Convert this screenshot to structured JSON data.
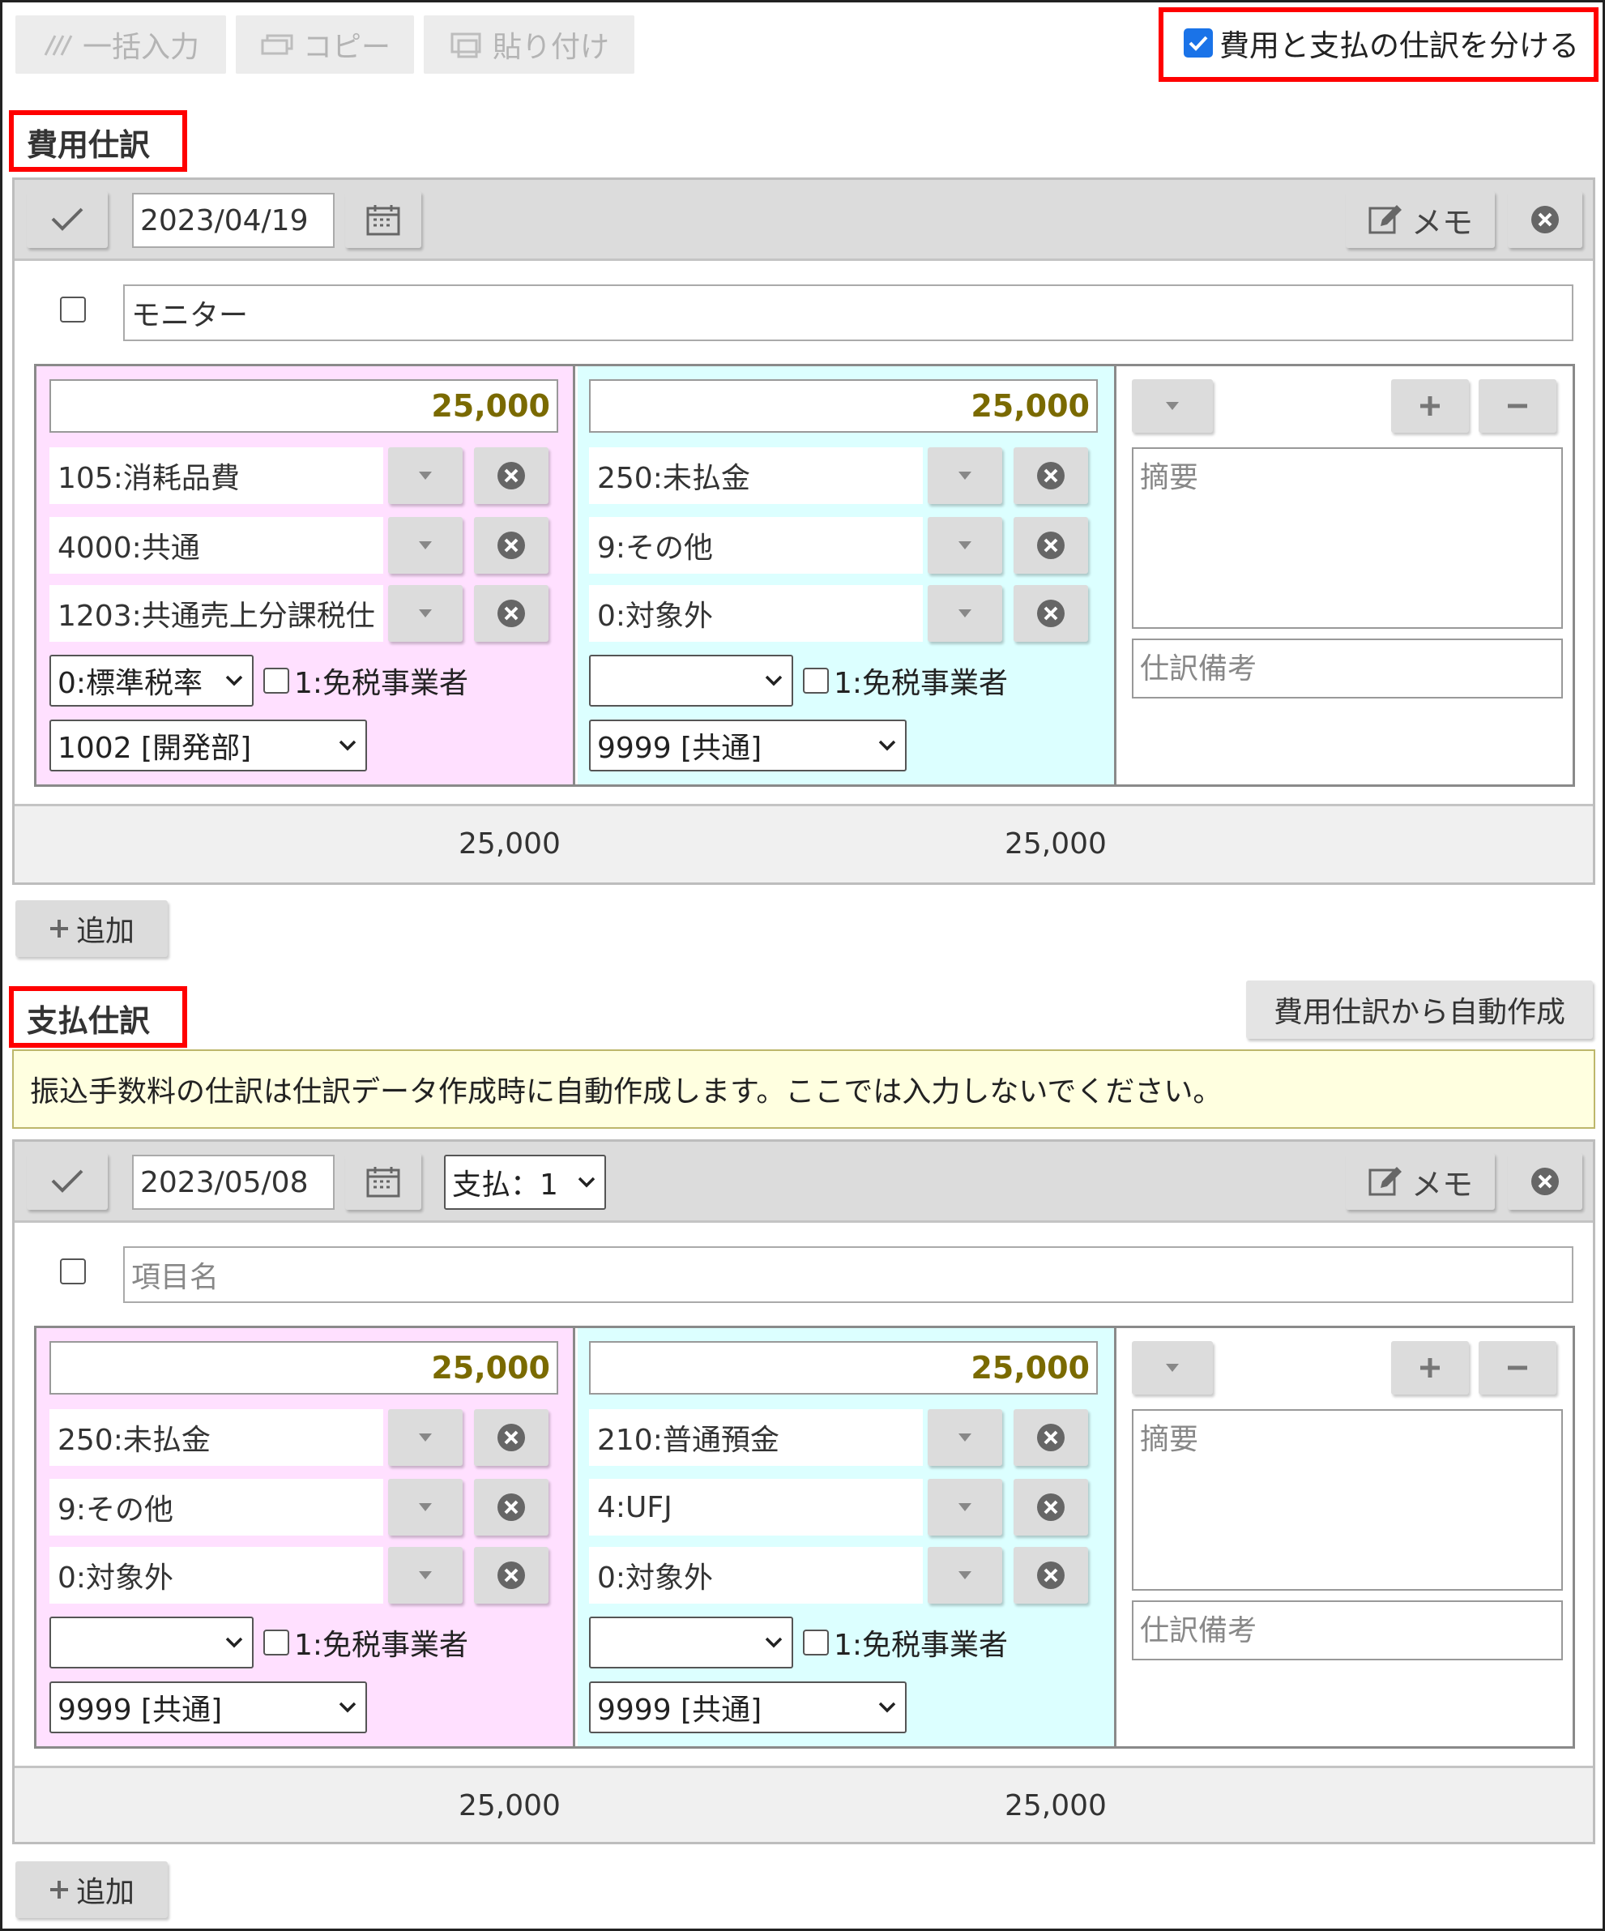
{
  "toolbar": {
    "bulk_input": "一括入力",
    "copy": "コピー",
    "paste": "貼り付け",
    "split_checkbox_label": "費用と支払の仕訳を分ける",
    "split_checked": true
  },
  "expense": {
    "title": "費用仕訳",
    "date": "2023/04/19",
    "memo_label": "メモ",
    "item_name": "モニター",
    "debit": {
      "amount": "25,000",
      "account": "105:消耗品費",
      "sub": "4000:共通",
      "tax": "1203:共通売上分課税仕",
      "tax_rate": "0:標準税率",
      "tax_exempt_label": "1:免税事業者",
      "dept": "1002 [開発部]"
    },
    "credit": {
      "amount": "25,000",
      "account": "250:未払金",
      "sub": "9:その他",
      "tax": "0:対象外",
      "tax_rate": "",
      "tax_exempt_label": "1:免税事業者",
      "dept": "9999 [共通]"
    },
    "summary_placeholder": "摘要",
    "remark_placeholder": "仕訳備考",
    "total_debit": "25,000",
    "total_credit": "25,000",
    "add_label": "追加"
  },
  "payment": {
    "title": "支払仕訳",
    "auto_create_label": "費用仕訳から自動作成",
    "notice": "振込手数料の仕訳は仕訳データ作成時に自動作成します。ここでは入力しないでください。",
    "date": "2023/05/08",
    "payment_select": "支払：1",
    "memo_label": "メモ",
    "item_name_placeholder": "項目名",
    "debit": {
      "amount": "25,000",
      "account": "250:未払金",
      "sub": "9:その他",
      "tax": "0:対象外",
      "tax_rate": "",
      "tax_exempt_label": "1:免税事業者",
      "dept": "9999 [共通]"
    },
    "credit": {
      "amount": "25,000",
      "account": "210:普通預金",
      "sub": "4:UFJ",
      "tax": "0:対象外",
      "tax_rate": "",
      "tax_exempt_label": "1:免税事業者",
      "dept": "9999 [共通]"
    },
    "summary_placeholder": "摘要",
    "remark_placeholder": "仕訳備考",
    "total_debit": "25,000",
    "total_credit": "25,000",
    "add_label": "追加"
  },
  "colors": {
    "highlight": "#ff0000",
    "debit_bg": "#ffe0ff",
    "credit_bg": "#dcffff",
    "amount_text": "#7a6a00",
    "notice_bg": "#ffffe0"
  },
  "icons": [
    "pencil-lines-icon",
    "copy-icon",
    "paste-icon",
    "check-icon",
    "calendar-icon",
    "memo-edit-icon",
    "close-circle-icon",
    "dropdown-icon",
    "plus-icon",
    "minus-icon"
  ]
}
